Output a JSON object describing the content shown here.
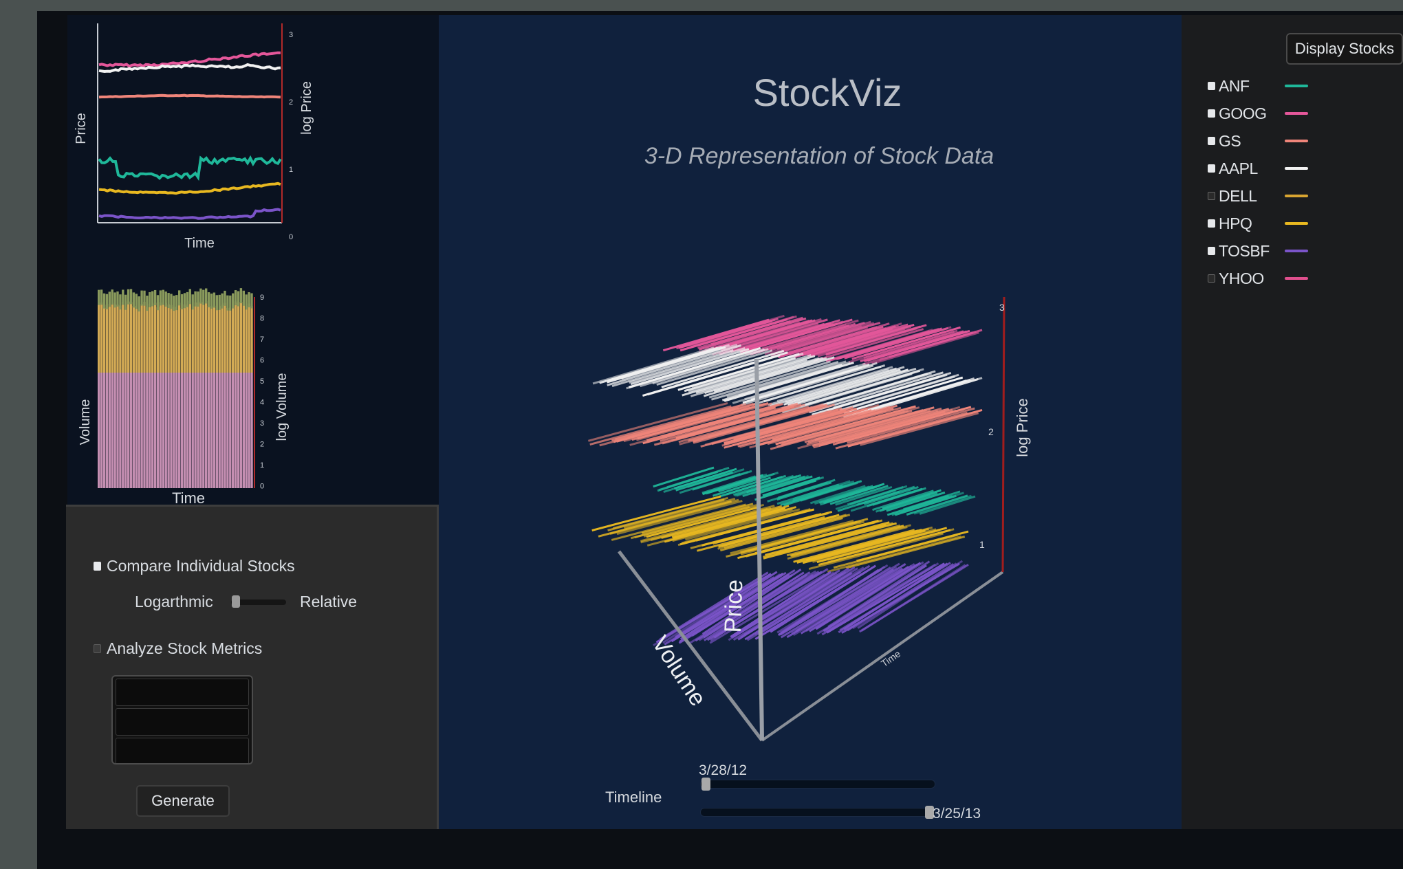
{
  "price_chart": {
    "ylabel": "Price",
    "ylabel_right": "log Price",
    "xlabel": "Time",
    "right_ticks": [
      "3",
      "2",
      "1",
      "0"
    ]
  },
  "volume_chart": {
    "ylabel": "Volume",
    "ylabel_right": "log Volume",
    "xlabel": "Time",
    "right_ticks": [
      "9",
      "8",
      "7",
      "6",
      "5",
      "4",
      "3",
      "2",
      "1",
      "0"
    ]
  },
  "controls": {
    "compare_label": "Compare Individual Stocks",
    "compare_checked": true,
    "scale_left": "Logarthmic",
    "scale_right": "Relative",
    "scale_value": 0,
    "analyze_label": "Analyze Stock Metrics",
    "analyze_checked": false,
    "generate_label": "Generate"
  },
  "viz": {
    "title": "StockViz",
    "subtitle": "3-D Representation of Stock Data",
    "axis_price": "Price",
    "axis_volume": "Volume",
    "axis_time": "Time",
    "axis_log_price": "log Price",
    "log_price_ticks": [
      "3",
      "2",
      "1"
    ]
  },
  "timeline": {
    "label": "Timeline",
    "start_date": "3/28/12",
    "end_date": "3/25/13",
    "start_value": 0,
    "end_value": 1
  },
  "legend": {
    "display_button": "Display Stocks",
    "items": [
      {
        "name": "ANF",
        "checked": true,
        "color": "#1fb89a"
      },
      {
        "name": "GOOG",
        "checked": true,
        "color": "#e4579a"
      },
      {
        "name": "GS",
        "checked": true,
        "color": "#f0857a"
      },
      {
        "name": "AAPL",
        "checked": true,
        "color": "#f2f2f2"
      },
      {
        "name": "DELL",
        "checked": false,
        "color": "#d9a531"
      },
      {
        "name": "HPQ",
        "checked": true,
        "color": "#e8b820"
      },
      {
        "name": "TOSBF",
        "checked": true,
        "color": "#7b54c9"
      },
      {
        "name": "YHOO",
        "checked": false,
        "color": "#e04f8d"
      }
    ]
  }
}
